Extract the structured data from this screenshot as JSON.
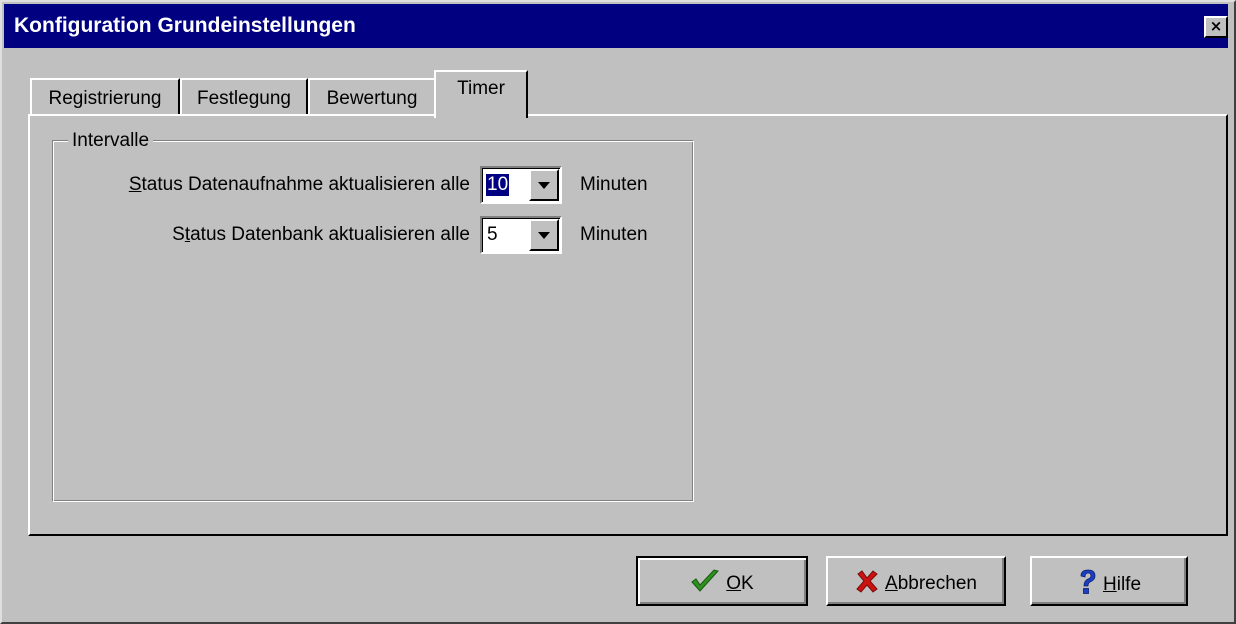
{
  "window": {
    "title": "Konfiguration Grundeinstellungen",
    "close_label": "×"
  },
  "tabs": [
    {
      "label": "Registrierung",
      "active": false
    },
    {
      "label": "Festlegung",
      "active": false
    },
    {
      "label": "Bewertung",
      "active": false
    },
    {
      "label": "Timer",
      "active": true
    }
  ],
  "group": {
    "title": "Intervalle",
    "rows": [
      {
        "label_mnemonic": "S",
        "label_rest": "tatus Datenaufnahme aktualisieren alle",
        "value": "10",
        "unit": "Minuten"
      },
      {
        "label_start": "S",
        "label_mnemonic": "t",
        "label_rest": "atus Datenbank aktualisieren alle",
        "value": "5",
        "unit": "Minuten"
      }
    ]
  },
  "buttons": {
    "ok": {
      "mnemonic": "O",
      "rest": "K",
      "icon": "checkmark-icon"
    },
    "cancel": {
      "mnemonic": "A",
      "rest": "bbrechen",
      "icon": "cross-icon"
    },
    "help": {
      "mnemonic": "H",
      "rest": "ilfe",
      "icon": "question-mark-icon"
    }
  },
  "colors": {
    "titlebar": "#000080",
    "face": "#c0c0c0",
    "check": "#2f8f1f",
    "cross": "#cc1111",
    "help": "#1a3fc4"
  }
}
